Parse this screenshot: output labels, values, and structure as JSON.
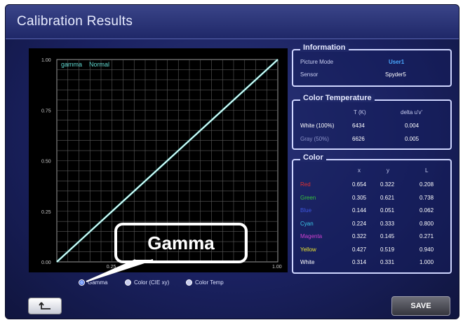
{
  "window": {
    "title": "Calibration Results"
  },
  "chart": {
    "legend": {
      "label": "gamma",
      "series": "Normal"
    },
    "y_ticks": [
      "1.00",
      "0.75",
      "0.50",
      "0.25",
      "0.00"
    ],
    "x_ticks": [
      "0.25",
      "1.00"
    ]
  },
  "chart_data": {
    "type": "line",
    "title": "",
    "xlabel": "",
    "ylabel": "",
    "xlim": [
      0,
      1
    ],
    "ylim": [
      0,
      1
    ],
    "grid": true,
    "legend_placement": "top-left",
    "series": [
      {
        "name": "Normal",
        "color": "#5fd8d0",
        "x": [
          0,
          0.25,
          0.5,
          0.75,
          1.0
        ],
        "y": [
          0,
          0.25,
          0.5,
          0.75,
          1.0
        ]
      },
      {
        "name": "gamma",
        "color": "#ffffff",
        "x": [
          0,
          0.25,
          0.5,
          0.75,
          1.0
        ],
        "y": [
          0,
          0.25,
          0.5,
          0.75,
          1.0
        ]
      }
    ]
  },
  "callout": {
    "label": "Gamma"
  },
  "radios": [
    {
      "label": "Gamma",
      "selected": true
    },
    {
      "label": "Color (CIE xy)",
      "selected": false
    },
    {
      "label": "Color Temp",
      "selected": false
    }
  ],
  "information": {
    "title": "Information",
    "rows": [
      {
        "label": "Picture Mode",
        "value": "User1",
        "value_color": "#4aa8ff"
      },
      {
        "label": "Sensor",
        "value": "Spyder5",
        "value_color": "#ffffff"
      }
    ]
  },
  "color_temperature": {
    "title": "Color Temperature",
    "headers": [
      "T (K)",
      "delta u'v'"
    ],
    "rows": [
      {
        "label": "White (100%)",
        "t": "6434",
        "delta": "0.004",
        "label_color": "#ffffff"
      },
      {
        "label": "Gray (50%)",
        "t": "6626",
        "delta": "0.005",
        "label_color": "#8c93c8"
      }
    ]
  },
  "color": {
    "title": "Color",
    "headers": [
      "x",
      "y",
      "L"
    ],
    "rows": [
      {
        "label": "Red",
        "x": "0.654",
        "y": "0.322",
        "L": "0.208",
        "label_color": "#e03030"
      },
      {
        "label": "Green",
        "x": "0.305",
        "y": "0.621",
        "L": "0.738",
        "label_color": "#36c23c"
      },
      {
        "label": "Blue",
        "x": "0.144",
        "y": "0.051",
        "L": "0.062",
        "label_color": "#3d55e0"
      },
      {
        "label": "Cyan",
        "x": "0.224",
        "y": "0.333",
        "L": "0.800",
        "label_color": "#3ac8e8"
      },
      {
        "label": "Magenta",
        "x": "0.322",
        "y": "0.145",
        "L": "0.271",
        "label_color": "#d040d0"
      },
      {
        "label": "Yellow",
        "x": "0.427",
        "y": "0.519",
        "L": "0.940",
        "label_color": "#e8e030"
      },
      {
        "label": "White",
        "x": "0.314",
        "y": "0.331",
        "L": "1.000",
        "label_color": "#ffffff"
      }
    ]
  },
  "buttons": {
    "back_icon": "return-arrow-icon",
    "save": "SAVE"
  }
}
